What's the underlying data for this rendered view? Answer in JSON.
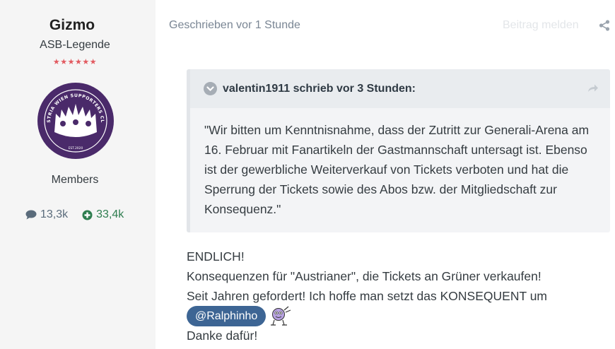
{
  "author": {
    "name": "Gizmo",
    "rank": "ASB-Legende",
    "stars": "★★★★★★",
    "avatar_text": "AUSTRIA WIEN SUPPORTERS CLUB",
    "avatar_est": "EST.2020",
    "group": "Members",
    "posts_count": "13,3k",
    "reputation": "33,4k"
  },
  "post": {
    "meta": "Geschrieben vor 1 Stunde",
    "report_label": "Beitrag melden"
  },
  "quote": {
    "author_line": "valentin1911 schrieb vor 3 Stunden:",
    "lines": [
      "\"Wir bitten um Kenntnisnahme, dass der Zutritt zur Generali-Arena am",
      "16. Februar mit Fanartikeln der Gastmannschaft untersagt ist. Ebenso",
      "ist der gewerbliche Weiterverkauf von Tickets verboten und hat die",
      "Sperrung der Tickets sowie des Abos bzw. der Mitgliedschaft zur",
      "Konsequenz.\""
    ]
  },
  "content": {
    "line1": "ENDLICH!",
    "line2": "Konsequenzen für \"Austrianer\", die Tickets an Grüner verkaufen!",
    "line3": "Seit Jahren gefordert! Ich hoffe man setzt das KONSEQUENT um",
    "mention": "@Ralphinho",
    "line5": "Danke dafür!"
  },
  "colors": {
    "sidebar_bg": "#f5f5f5",
    "stars": "#e25a60",
    "mention_bg": "#3d6594",
    "reputation": "#2e7d4f",
    "avatar_bg": "#4a2a6a"
  },
  "icons": {
    "posts": "comment-icon",
    "reputation": "plus-circle-icon",
    "share": "share-icon",
    "quote_toggle": "chevron-down-icon",
    "quote_goto": "arrow-right-icon",
    "emoticon": "smiley-icon"
  }
}
